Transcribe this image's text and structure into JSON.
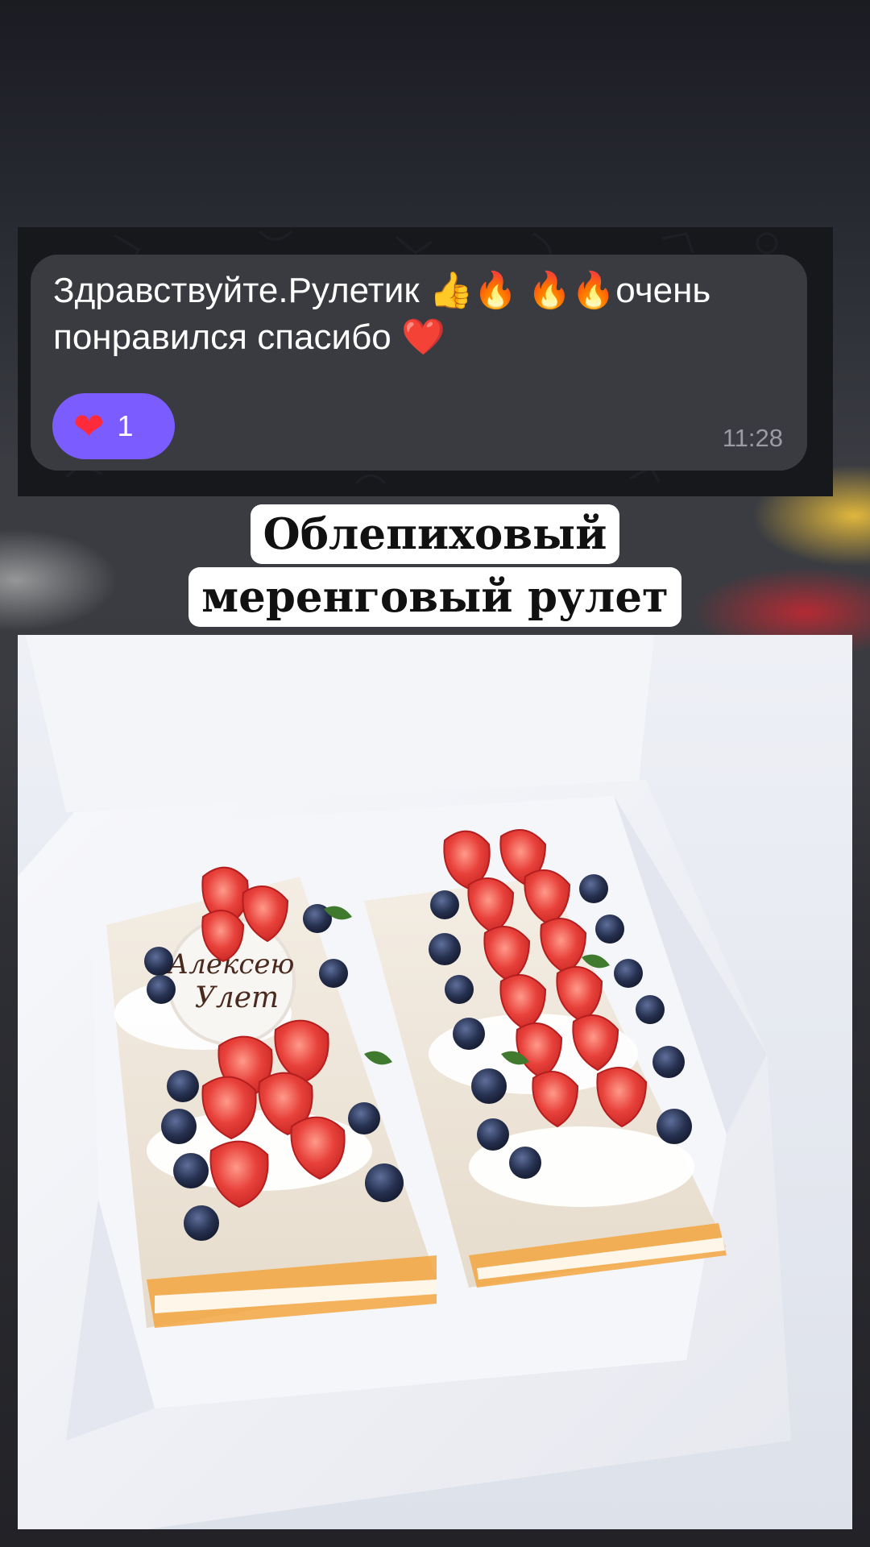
{
  "chat": {
    "message": "Здравствуйте.Рулетик 👍🔥 🔥🔥очень\nпонравился спасибо ❤️",
    "reaction": {
      "emoji": "❤",
      "count": "1",
      "color": "#7b5cff"
    },
    "time": "11:28",
    "bubble_color": "#3a3b41"
  },
  "caption": {
    "line1": "Облепиховый",
    "line2": "меренговый рулет"
  },
  "photo": {
    "description_icon": "meringue-roll-photo",
    "plaque_line1": "Алексею",
    "plaque_line2": "Улет"
  }
}
